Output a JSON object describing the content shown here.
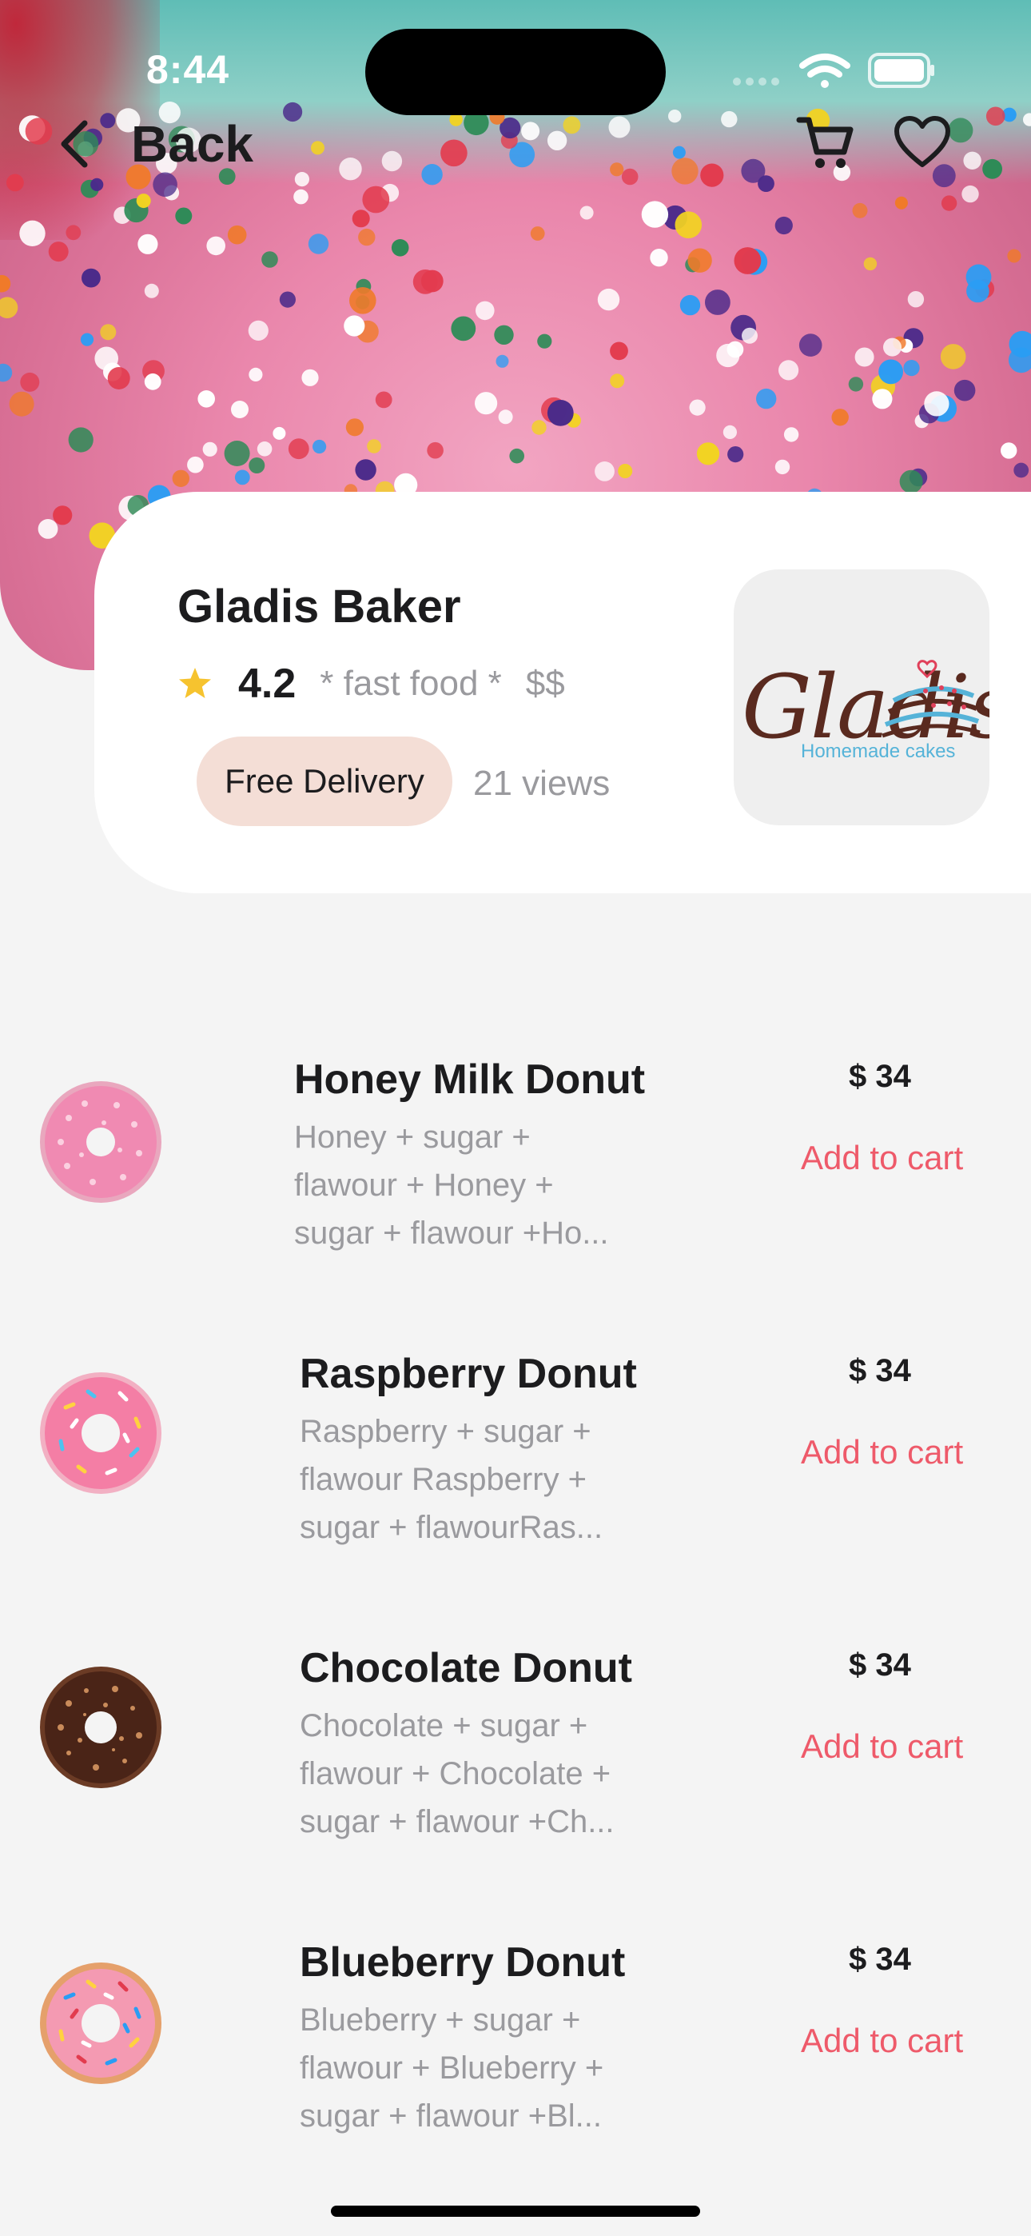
{
  "status_bar": {
    "time": "8:44"
  },
  "nav": {
    "back_label": "Back"
  },
  "shop": {
    "name": "Gladis Baker",
    "rating": "4.2",
    "category": "* fast food *",
    "price_level": "$$",
    "delivery_badge": "Free Delivery",
    "views": "21 views",
    "logo_wordmark": "Gladis",
    "logo_tagline": "Homemade cakes"
  },
  "products": [
    {
      "title": "Honey Milk Donut",
      "desc_lines": [
        "Honey + sugar +",
        "flawour + Honey +",
        "sugar + flawour +Ho..."
      ],
      "price": "$ 34",
      "action": "Add to cart",
      "icon": "pink-donut-icon"
    },
    {
      "title": "Raspberry Donut",
      "desc_lines": [
        "Raspberry + sugar +",
        "flawour Raspberry +",
        "sugar + flawourRas..."
      ],
      "price": "$ 34",
      "action": "Add to cart",
      "icon": "sprinkle-donut-icon"
    },
    {
      "title": "Chocolate Donut",
      "desc_lines": [
        "Chocolate + sugar +",
        "flawour + Chocolate +",
        "sugar + flawour +Ch..."
      ],
      "price": "$ 34",
      "action": "Add to cart",
      "icon": "chocolate-donut-icon"
    },
    {
      "title": "Blueberry Donut",
      "desc_lines": [
        "Blueberry + sugar +",
        "flawour + Blueberry +",
        "sugar + flawour +Bl..."
      ],
      "price": "$ 34",
      "action": "Add to cart",
      "icon": "sprinkle-donut-icon"
    }
  ],
  "colors": {
    "accent": "#ee5a6a",
    "badge_bg": "#f4ded6",
    "star": "#f6c32f",
    "background": "#f4f4f4"
  }
}
